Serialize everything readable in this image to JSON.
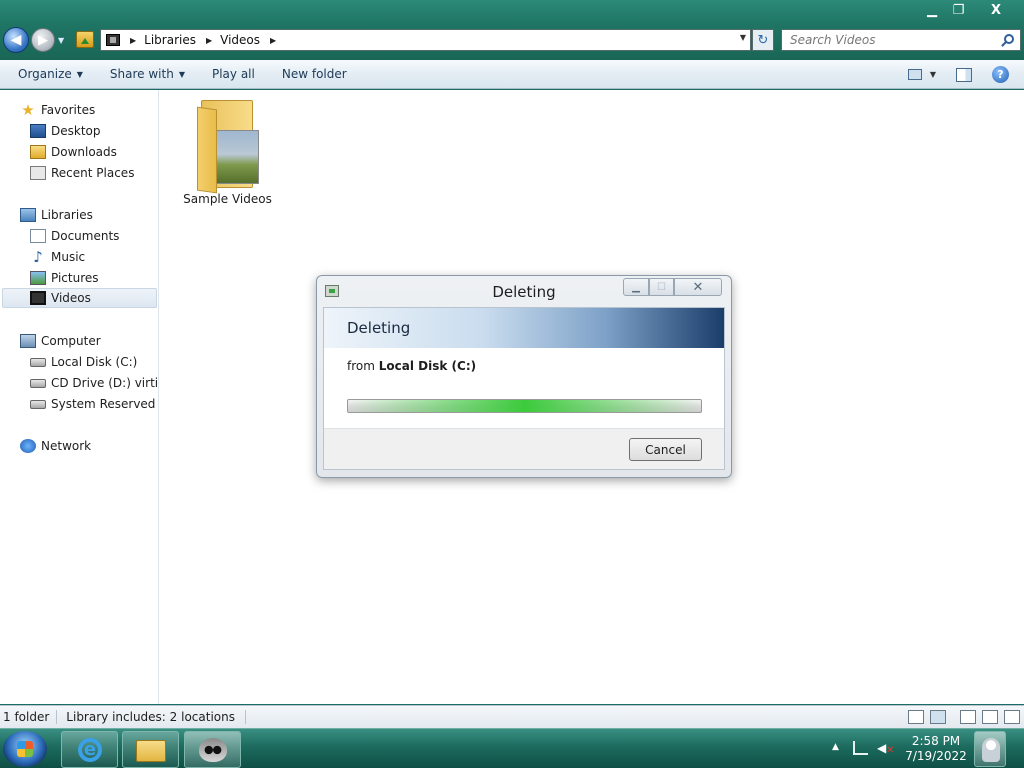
{
  "window": {
    "min_glyph": "▁",
    "max_glyph": "❐",
    "close_glyph": "X"
  },
  "nav": {
    "back_glyph": "◀",
    "forward_glyph": "▶",
    "dropdown_glyph": "▼"
  },
  "address": {
    "crumbs": [
      "Libraries",
      "Videos"
    ],
    "arrow_glyph": "▶",
    "dropdown_glyph": "▼",
    "refresh_glyph": "↻"
  },
  "search": {
    "placeholder": "Search Videos"
  },
  "toolbar": {
    "organize": "Organize",
    "share_with": "Share with",
    "play_all": "Play all",
    "new_folder": "New folder",
    "dropdown_glyph": "▼",
    "help_glyph": "?"
  },
  "sidebar": {
    "favorites": "Favorites",
    "desktop": "Desktop",
    "downloads": "Downloads",
    "recent_places": "Recent Places",
    "libraries": "Libraries",
    "documents": "Documents",
    "music": "Music",
    "pictures": "Pictures",
    "videos": "Videos",
    "computer": "Computer",
    "local_disk": "Local Disk (C:)",
    "cd_drive": "CD Drive (D:) virtio-w",
    "system_reserved": "System Reserved (E:)",
    "network": "Network",
    "star_glyph": "★",
    "music_glyph": "♪"
  },
  "files": [
    {
      "name": "Sample Videos",
      "type": "folder"
    }
  ],
  "dialog": {
    "title": "Deleting",
    "header": "Deleting",
    "from_prefix": "from",
    "from_location": "Local Disk (C:)",
    "cancel": "Cancel",
    "min_glyph": "▁",
    "max_glyph": "☐",
    "close_glyph": "✕",
    "progress_state": "indeterminate"
  },
  "status": {
    "count": "1 folder",
    "library_includes": "Library includes:  2 locations"
  },
  "taskbar": {
    "time": "2:58 PM",
    "date": "7/19/2022",
    "ie_glyph": "e",
    "tray_arrow_glyph": "▲",
    "volume_glyph": "◀",
    "mute_glyph": "✕"
  }
}
